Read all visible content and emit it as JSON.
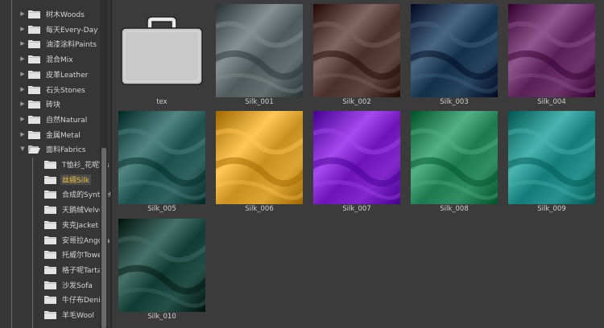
{
  "sidebar": {
    "items": [
      {
        "label": "树木Woods",
        "expanded": false,
        "selected": false
      },
      {
        "label": "每天Every-Day",
        "expanded": false,
        "selected": false
      },
      {
        "label": "油漆涂料Paints",
        "expanded": false,
        "selected": false
      },
      {
        "label": "混合Mix",
        "expanded": false,
        "selected": false
      },
      {
        "label": "皮革Leather",
        "expanded": false,
        "selected": false
      },
      {
        "label": "石头Stones",
        "expanded": false,
        "selected": false
      },
      {
        "label": "砖块",
        "expanded": false,
        "selected": false
      },
      {
        "label": "自然Natural",
        "expanded": false,
        "selected": false
      },
      {
        "label": "金属Metal",
        "expanded": false,
        "selected": false
      },
      {
        "label": "面料Fabrics",
        "expanded": true,
        "selected": false
      },
      {
        "label": "T恤衫_花呢T-s",
        "expanded": false,
        "selected": false
      },
      {
        "label": "丝绸Silk",
        "expanded": false,
        "selected": true
      },
      {
        "label": "合成的Synthet",
        "expanded": false,
        "selected": false
      },
      {
        "label": "天鹅绒Velvet",
        "expanded": false,
        "selected": false
      },
      {
        "label": "夹克Jacket",
        "expanded": false,
        "selected": false
      },
      {
        "label": "安哥拉Angora",
        "expanded": false,
        "selected": false
      },
      {
        "label": "托威尔Towell",
        "expanded": false,
        "selected": false
      },
      {
        "label": "格子呢Tartan",
        "expanded": false,
        "selected": false
      },
      {
        "label": "沙发Sofa",
        "expanded": false,
        "selected": false
      },
      {
        "label": "牛仔布Denim",
        "expanded": false,
        "selected": false
      },
      {
        "label": "羊毛Wool",
        "expanded": false,
        "selected": false
      }
    ]
  },
  "grid": {
    "items": [
      {
        "caption": "tex",
        "kind": "folder",
        "color": "#c9c9c9"
      },
      {
        "caption": "Silk_001",
        "kind": "swatch",
        "color": "#4f5a5c"
      },
      {
        "caption": "Silk_002",
        "kind": "swatch",
        "color": "#4a3028"
      },
      {
        "caption": "Silk_003",
        "kind": "swatch",
        "color": "#12304a"
      },
      {
        "caption": "Silk_004",
        "kind": "swatch",
        "color": "#5a1f57"
      },
      {
        "caption": "Silk_005",
        "kind": "swatch",
        "color": "#1b4f4c"
      },
      {
        "caption": "Silk_006",
        "kind": "swatch",
        "color": "#c7901f"
      },
      {
        "caption": "Silk_007",
        "kind": "swatch",
        "color": "#6e13b8"
      },
      {
        "caption": "Silk_008",
        "kind": "swatch",
        "color": "#1c7a4f"
      },
      {
        "caption": "Silk_009",
        "kind": "swatch",
        "color": "#137d79"
      },
      {
        "caption": "Silk_010",
        "kind": "swatch",
        "color": "#0f3b33"
      }
    ]
  },
  "colors": {
    "background": "#3b3b3b",
    "sidebar": "#363636",
    "selected_text": "#f1c23b"
  }
}
